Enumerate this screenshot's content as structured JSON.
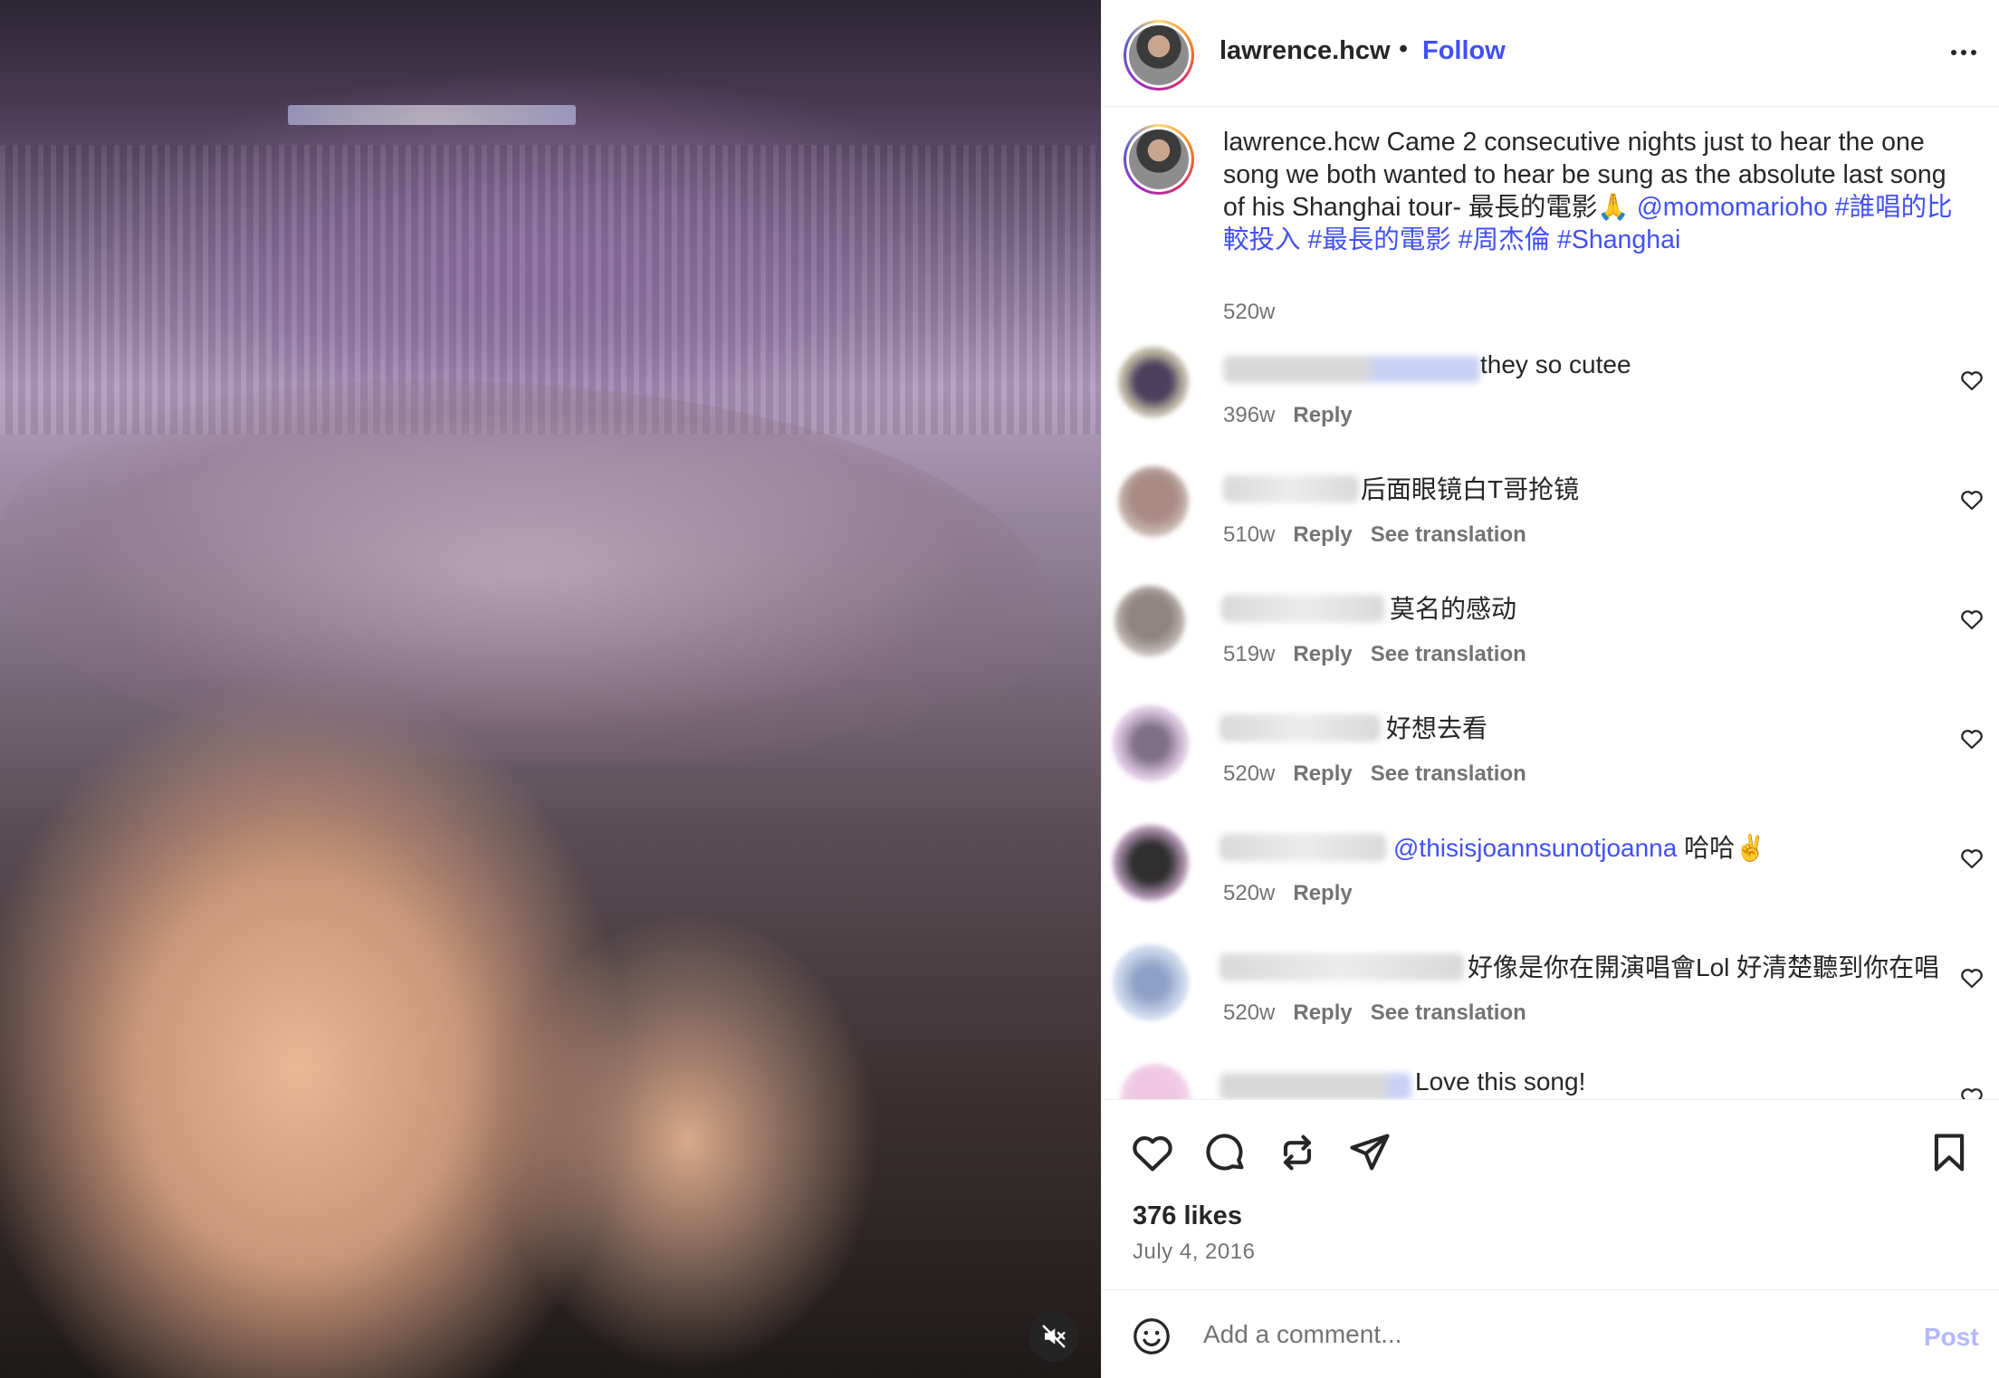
{
  "post": {
    "username": "lawrence.hcw",
    "separator": "•",
    "follow_label": "Follow",
    "caption": {
      "username": "lawrence.hcw",
      "text": " Came 2 consecutive nights just to hear the one song we both wanted to hear be sung as the absolute last song of his Shanghai tour- 最長的電影🙏 ",
      "mention": "@momomarioho",
      "hashtags": [
        "#誰唱的比較投入",
        "#最長的電影",
        "#周杰倫",
        "#Shanghai"
      ],
      "time": "520w"
    },
    "likes": "376 likes",
    "date": "July 4, 2016"
  },
  "comments": [
    {
      "text": "they so cutee",
      "time": "396w",
      "reply": "Reply",
      "see_translation": ""
    },
    {
      "text": "后面眼镜白T哥抢镜",
      "time": "510w",
      "reply": "Reply",
      "see_translation": "See translation"
    },
    {
      "text": "莫名的感动",
      "time": "519w",
      "reply": "Reply",
      "see_translation": "See translation"
    },
    {
      "text": "好想去看",
      "time": "520w",
      "reply": "Reply",
      "see_translation": "See translation"
    },
    {
      "mention": "@thisisjoannsunotjoanna",
      "text": " 哈哈✌️",
      "time": "520w",
      "reply": "Reply",
      "see_translation": ""
    },
    {
      "text": "好像是你在開演唱會Lol 好清楚聽到你在唱",
      "time": "520w",
      "reply": "Reply",
      "see_translation": "See translation"
    },
    {
      "text": "Love this song!",
      "time": "",
      "reply": "",
      "see_translation": ""
    }
  ],
  "composer": {
    "placeholder": "Add a comment...",
    "post_label": "Post"
  },
  "colors": {
    "link": "#4150f7",
    "muted": "#737373",
    "post_disabled": "#b2b8fa",
    "text": "#262626"
  },
  "icons": {
    "media": [
      "mute-icon"
    ],
    "actions": [
      "heart-icon",
      "comment-icon",
      "repost-icon",
      "share-icon",
      "bookmark-icon"
    ],
    "header": [
      "more-options-icon"
    ],
    "composer": [
      "emoji-icon"
    ]
  }
}
